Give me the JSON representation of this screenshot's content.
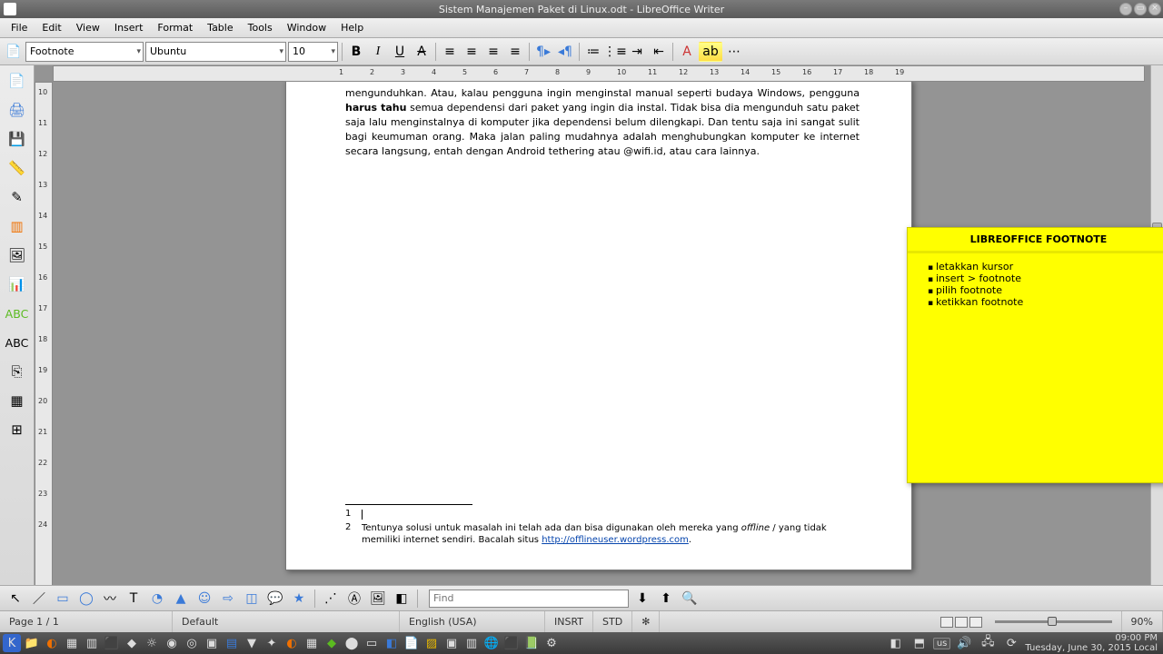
{
  "title": "Sistem Manajemen Paket di Linux.odt - LibreOffice Writer",
  "menu": [
    "File",
    "Edit",
    "View",
    "Insert",
    "Format",
    "Table",
    "Tools",
    "Window",
    "Help"
  ],
  "style_dd": "Footnote",
  "font_dd": "Ubuntu",
  "size_dd": "10",
  "body": {
    "prefix": "mengunduhkan. Atau, kalau pengguna ingin menginstal manual seperti budaya Windows, pengguna ",
    "bold": "harus tahu",
    "rest": " semua dependensi dari paket yang ingin dia instal. Tidak bisa dia mengunduh satu paket saja lalu menginstalnya di komputer jika dependensi belum dilengkapi. Dan tentu saja ini sangat sulit bagi keumuman orang. Maka jalan paling mudahnya adalah menghubungkan komputer ke internet secara langsung, entah dengan Android  tethering atau @wifi.id, atau cara lainnya."
  },
  "fn1_num": "1",
  "fn2_num": "2",
  "fn2_a": "Tentunya solusi untuk masalah ini telah ada dan bisa digunakan oleh mereka yang ",
  "fn2_italic": "offline",
  "fn2_b": " / yang tidak memiliki internet sendiri. Bacalah situs ",
  "fn2_link": "http://offlineuser.wordpress.com",
  "sticky": {
    "title": "LIBREOFFICE FOOTNOTE",
    "items": [
      "letakkan kursor",
      "insert > footnote",
      "pilih footnote",
      "ketikkan footnote"
    ]
  },
  "find_ph": "Find",
  "status": {
    "page": "Page 1 / 1",
    "style": "Default",
    "lang": "English (USA)",
    "insrt": "INSRT",
    "std": "STD",
    "zoom": "90%"
  },
  "tray": {
    "kb": "us",
    "time": "09:00 PM",
    "date": "Tuesday, June 30, 2015 Local"
  }
}
